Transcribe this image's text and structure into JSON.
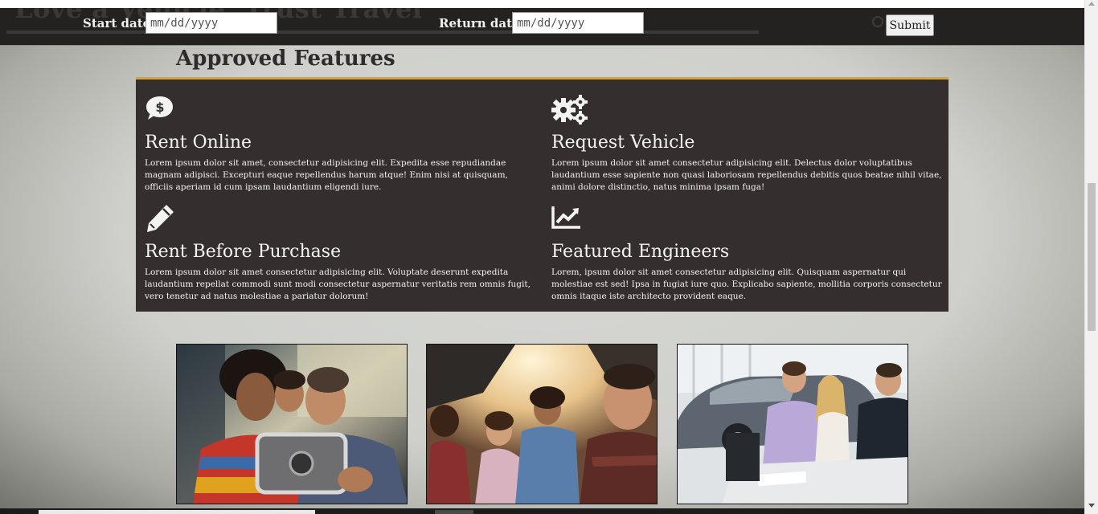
{
  "header": {
    "background_quote": "Love a Vehicle, Trust Travel",
    "start_date_label": "Start date:",
    "start_date_placeholder": "mm/dd/yyyy",
    "return_date_label": "Return date:",
    "return_date_placeholder": "mm/dd/yyyy",
    "submit_label": "Submit"
  },
  "section": {
    "title": "Approved Features"
  },
  "features": [
    {
      "icon": "dollar-speech-bubble-icon",
      "title": "Rent Online",
      "text": "Lorem ipsum dolor sit amet, consectetur adipisicing elit. Expedita esse repudiandae magnam adipisci. Excepturi eaque repellendus harum atque! Enim nisi at quisquam, officiis aperiam id cum ipsam laudantium eligendi iure."
    },
    {
      "icon": "gears-icon",
      "title": "Request Vehicle",
      "text": "Lorem ipsum dolor sit amet consectetur adipisicing elit. Delectus dolor voluptatibus laudantium esse sapiente non quasi laboriosam repellendus debitis quos beatae nihil vitae, animi dolore distinctio, natus minima ipsam fuga!"
    },
    {
      "icon": "pencil-icon",
      "title": "Rent Before Purchase",
      "text": "Lorem ipsum dolor sit amet consectetur adipisicing elit. Voluptate deserunt expedita laudantium repellat commodi sunt modi consectetur aspernatur veritatis rem omnis fugit, vero tenetur ad natus molestiae a pariatur dolorum!"
    },
    {
      "icon": "line-chart-icon",
      "title": "Featured Engineers",
      "text": "Lorem, ipsum dolor sit amet consectetur adipisicing elit. Quisquam aspernatur qui molestiae est sed! Ipsa in fugiat iure quo. Explicabo sapiente, mollitia corporis consectetur omnis itaque iste architecto provident eaque."
    }
  ],
  "colors": {
    "panel_background": "#352e2e",
    "panel_accent": "#d8a23a",
    "header_background": "#232221"
  }
}
